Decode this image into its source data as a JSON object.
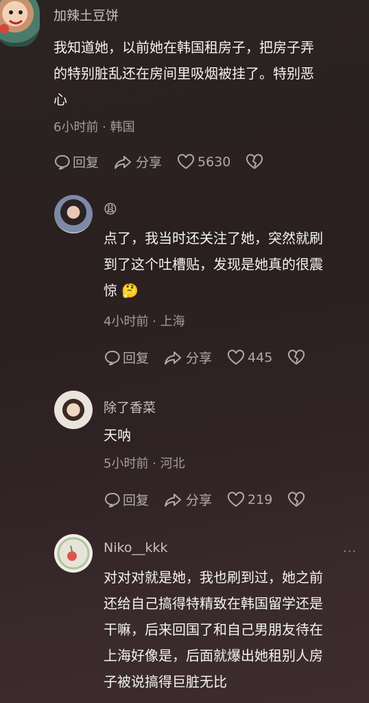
{
  "comments": [
    {
      "username": "加辣土豆饼",
      "lines": [
        "我知道她，以前她在韩国租房子，把房子弄",
        "的特别脏乱还在房间里吸烟被挂了。特别恶",
        "心"
      ],
      "meta": "6小时前 · 韩国",
      "reply_label": "回复",
      "share_label": "分享",
      "likes": "5630"
    },
    {
      "username": "😩",
      "lines": [
        "点了，我当时还关注了她，突然就刷",
        "到了这个吐槽贴，发现是她真的很震",
        "惊 🤔"
      ],
      "meta": "4小时前 · 上海",
      "reply_label": "回复",
      "share_label": "分享",
      "likes": "445"
    },
    {
      "username": "除了香菜",
      "lines": [
        "天呐"
      ],
      "meta": "5小时前 · 河北",
      "reply_label": "回复",
      "share_label": "分享",
      "likes": "219"
    },
    {
      "username": "Niko__kkk",
      "more": "···",
      "lines": [
        "对对对就是她，我也刷到过，她之前",
        "还给自己搞得特精致在韩国留学还是",
        "干嘛，后来回国了和自己男朋友待在",
        "上海好像是，后面就爆出她租别人房",
        "子被说搞得巨脏无比"
      ]
    }
  ],
  "icons": {
    "reply": "comment-bubble-icon",
    "share": "share-arrow-icon",
    "like": "heart-icon",
    "dislike": "broken-heart-icon"
  }
}
